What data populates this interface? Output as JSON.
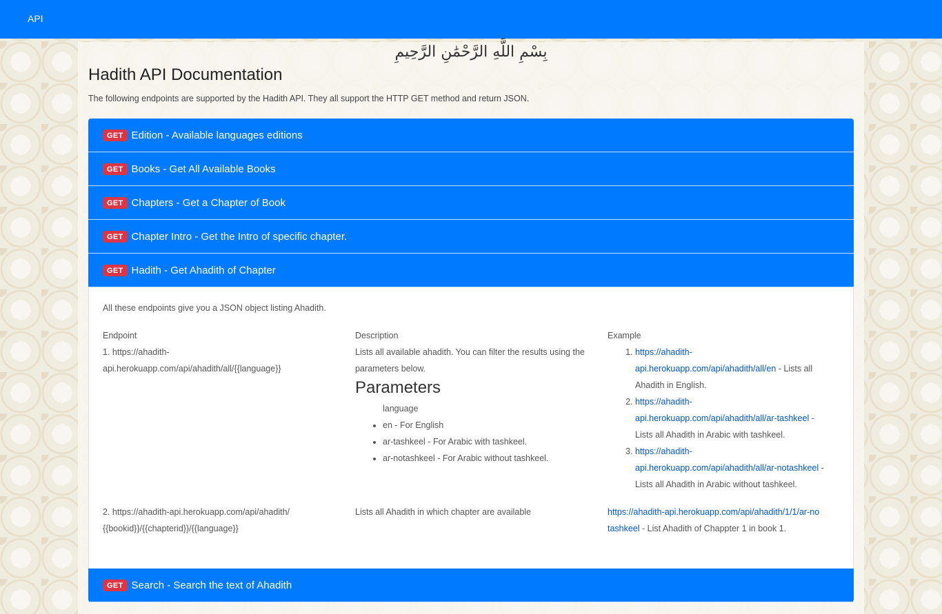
{
  "nav": {
    "brand": "API"
  },
  "header": {
    "basmala": "بِسْمِ اللَّهِ الرَّحْمَٰنِ الرَّحِيمِ",
    "title": "Hadith API Documentation",
    "intro": "The following endpoints are supported by the Hadith API. They all support the HTTP GET method and return JSON."
  },
  "accordion": {
    "method_label": "GET",
    "sections": [
      {
        "title": "Edition - Available languages editions"
      },
      {
        "title": "Books - Get All Available Books"
      },
      {
        "title": "Chapters - Get a Chapter of Book"
      },
      {
        "title": "Chapter Intro - Get the Intro of specific chapter."
      },
      {
        "title": "Hadith - Get Ahadith of Chapter"
      },
      {
        "title": "Search - Search the text of Ahadith"
      }
    ]
  },
  "hadith_panel": {
    "intro": "All these endpoints give you a JSON object listing Ahadith.",
    "headers": {
      "endpoint": "Endpoint",
      "description": "Description",
      "example": "Example"
    },
    "rows": [
      {
        "endpoint": "1. https://ahadith-api.herokuapp.com/api/ahadith/all/{{language}}",
        "description": "Lists all available ahadith. You can filter the results using the parameters below.",
        "parameters_title": "Parameters",
        "param_label": "language",
        "params": [
          "en - For English",
          "ar-tashkeel - For Arabic with tashkeel.",
          "ar-notashkeel - For Arabic without tashkeel."
        ],
        "examples": [
          {
            "url": "https://ahadith-api.herokuapp.com/api/ahadith/all/en",
            "text": " - Lists all Ahadith in English."
          },
          {
            "url": "https://ahadith-api.herokuapp.com/api/ahadith/all/ar-tashkeel",
            "text": " - Lists all Ahadith in Arabic with tashkeel."
          },
          {
            "url": "https://ahadith-api.herokuapp.com/api/ahadith/all/ar-notashkeel",
            "text": " - Lists all Ahadith in Arabic without tashkeel."
          }
        ]
      },
      {
        "endpoint": "2. https://ahadith-api.herokuapp.com/api/ahadith/{{bookid}}/{{chapterid}}/{{language}}",
        "description": "Lists all Ahadith in which chapter are available",
        "example_url": "https://ahadith-api.herokuapp.com/api/ahadith/1/1/ar-notashkeel",
        "example_text": " - List Ahadith of Chappter 1 in book 1."
      }
    ]
  }
}
